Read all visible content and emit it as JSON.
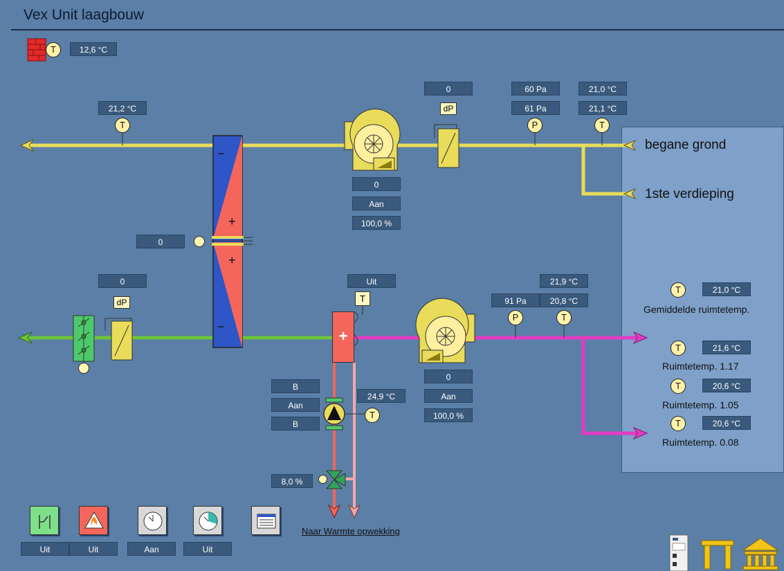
{
  "title": "Vex Unit laagbouw",
  "outdoor_temp": "12,6 °C",
  "exhaust": {
    "temp_out": "21,2 °C",
    "fan_value": "0",
    "fan_status": "Aan",
    "fan_speed": "100,0 %",
    "filter_dp": "0",
    "pressure_setpoint": "60 Pa",
    "pressure_actual": "61 Pa",
    "temp_setpoint": "21,0 °C",
    "temp_actual": "21,1 °C",
    "label_ground": "begane grond",
    "label_first": "1ste verdieping"
  },
  "heat_recovery": {
    "value": "0"
  },
  "supply": {
    "filter_dp": "0",
    "heater_status": "Uit",
    "pressure": "91 Pa",
    "temp_setpoint": "21,9 °C",
    "temp_actual": "20,8 °C",
    "fan_value": "0",
    "fan_status": "Aan",
    "fan_speed": "100,0 %"
  },
  "heating_circuit": {
    "pump_mode1": "B",
    "pump_status": "Aan",
    "pump_mode2": "B",
    "water_temp": "24,9 °C",
    "valve_position": "8,0 %",
    "link": "Naar Warmte opwekking"
  },
  "rooms": {
    "avg_temp": "21,0 °C",
    "avg_label": "Gemiddelde ruimtetemp.",
    "r1_temp": "21,6 °C",
    "r1_label": "Ruimtetemp. 1.17",
    "r2_temp": "20,6 °C",
    "r2_label": "Ruimtetemp. 1.05",
    "r3_temp": "20,6 °C",
    "r3_label": "Ruimtetemp. 0.08"
  },
  "symbols": {
    "temp": "T",
    "pressure": "P",
    "dp": "dP",
    "plus": "+",
    "minus": "−"
  },
  "bottom_buttons": [
    {
      "icon": "switch-icon",
      "status": "Uit"
    },
    {
      "icon": "fire-icon",
      "status": "Uit"
    },
    {
      "icon": "clock-icon",
      "status": "Aan"
    },
    {
      "icon": "schedule-icon",
      "status": "Uit"
    },
    {
      "icon": "report-icon"
    }
  ],
  "colors": {
    "exhaust_duct": "#e9dc5a",
    "supply_duct": "#6dc43c",
    "supply_hot": "#e23cc3",
    "heater": "#f4665c",
    "exchanger_blue": "#2e56c6",
    "panel": "#7ea0c9"
  }
}
